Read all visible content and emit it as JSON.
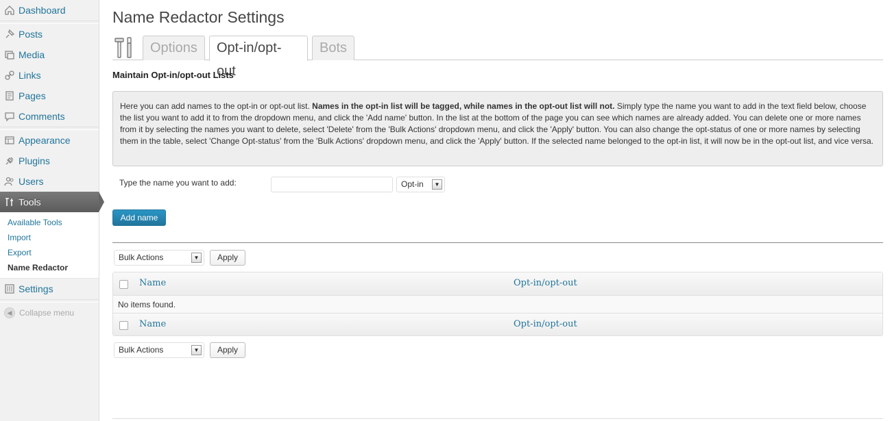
{
  "sidebar": {
    "items": [
      {
        "label": "Dashboard",
        "icon": "dashboard-icon"
      },
      {
        "label": "Posts",
        "icon": "pin-icon"
      },
      {
        "label": "Media",
        "icon": "media-icon"
      },
      {
        "label": "Links",
        "icon": "link-icon"
      },
      {
        "label": "Pages",
        "icon": "page-icon"
      },
      {
        "label": "Comments",
        "icon": "comment-icon"
      },
      {
        "label": "Appearance",
        "icon": "appearance-icon"
      },
      {
        "label": "Plugins",
        "icon": "plugin-icon"
      },
      {
        "label": "Users",
        "icon": "users-icon"
      },
      {
        "label": "Tools",
        "icon": "tools-icon"
      },
      {
        "label": "Settings",
        "icon": "settings-icon"
      }
    ],
    "tools_submenu": [
      "Available Tools",
      "Import",
      "Export",
      "Name Redactor"
    ],
    "collapse_label": "Collapse menu"
  },
  "page": {
    "title": "Name Redactor Settings",
    "tabs": [
      "Options",
      "Opt-in/opt-out",
      "Bots"
    ],
    "active_tab": "Opt-in/opt-out",
    "section_heading": "Maintain Opt-in/opt-out Lists",
    "info_intro": "Here you can add names to the opt-in or opt-out list. ",
    "info_bold": "Names in the opt-in list will be tagged, while names in the opt-out list will not.",
    "info_rest": " Simply type the name you want to add in the text field below, choose the list you want to add it to from the dropdown menu, and click the 'Add name' button. In the list at the bottom of the page you can see which names are already added. You can delete one or more names from it by selecting the names you want to delete, select 'Delete' from the 'Bulk Actions' dropdown menu, and click the 'Apply' button. You can also change the opt-status of one or more names by selecting them in the table, select 'Change Opt-status' from the 'Bulk Actions' dropdown menu, and click the 'Apply' button. If the selected name belonged to the opt-in list, it will now be in the opt-out list, and vice versa.",
    "add_label": "Type the name you want to add:",
    "name_value": "",
    "list_select_value": "Opt-in",
    "add_button": "Add name",
    "bulk_actions": "Bulk Actions",
    "apply_button": "Apply",
    "table": {
      "columns": [
        "Name",
        "Opt-in/opt-out"
      ],
      "empty_message": "No items found."
    }
  },
  "colors": {
    "accent": "#21759b",
    "sidebar_bg": "#f1f1f1",
    "current_menu": "#666666"
  }
}
